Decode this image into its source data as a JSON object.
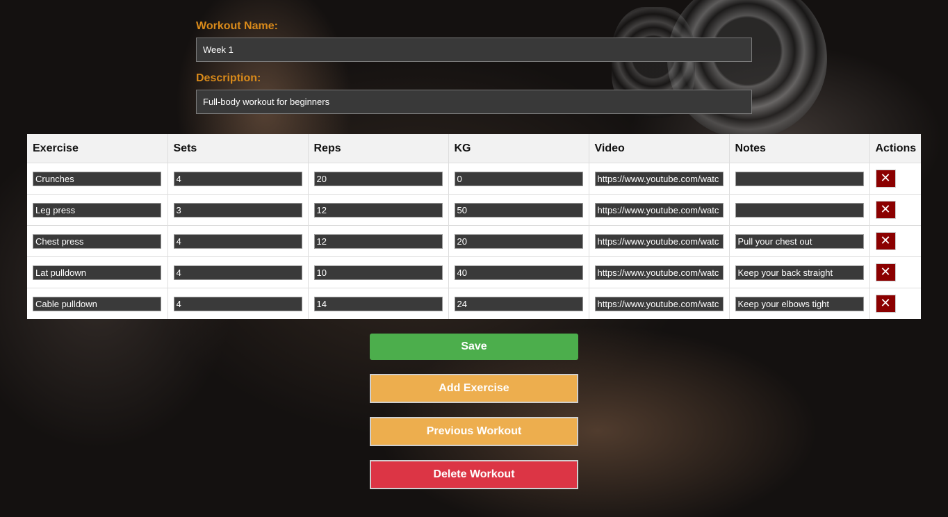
{
  "form": {
    "name_label": "Workout Name:",
    "name_value": "Week 1",
    "description_label": "Description:",
    "description_value": "Full-body workout for beginners"
  },
  "table": {
    "headers": [
      "Exercise",
      "Sets",
      "Reps",
      "KG",
      "Video",
      "Notes",
      "Actions"
    ],
    "rows": [
      {
        "exercise": "Crunches",
        "sets": "4",
        "reps": "20",
        "kg": "0",
        "video": "https://www.youtube.com/watc",
        "notes": "",
        "delete_symbol": "✕"
      },
      {
        "exercise": "Leg press",
        "sets": "3",
        "reps": "12",
        "kg": "50",
        "video": "https://www.youtube.com/watc",
        "notes": "",
        "delete_symbol": "✕"
      },
      {
        "exercise": "Chest press",
        "sets": "4",
        "reps": "12",
        "kg": "20",
        "video": "https://www.youtube.com/watc",
        "notes": "Pull your chest out",
        "delete_symbol": "✕"
      },
      {
        "exercise": "Lat pulldown",
        "sets": "4",
        "reps": "10",
        "kg": "40",
        "video": "https://www.youtube.com/watc",
        "notes": "Keep your back straight",
        "delete_symbol": "✕"
      },
      {
        "exercise": "Cable pulldown",
        "sets": "4",
        "reps": "14",
        "kg": "24",
        "video": "https://www.youtube.com/watc",
        "notes": "Keep your elbows tight",
        "delete_symbol": "✕"
      }
    ]
  },
  "buttons": {
    "save": "Save",
    "add_exercise": "Add Exercise",
    "previous_workout": "Previous Workout",
    "delete_workout": "Delete Workout"
  },
  "colors": {
    "label_orange": "#d98a1a",
    "save_green": "#4cae4c",
    "add_orange": "#edae4e",
    "delete_red": "#dc3545",
    "row_delete_red": "#8b0000"
  },
  "icons": {
    "row_delete": "close-icon"
  }
}
